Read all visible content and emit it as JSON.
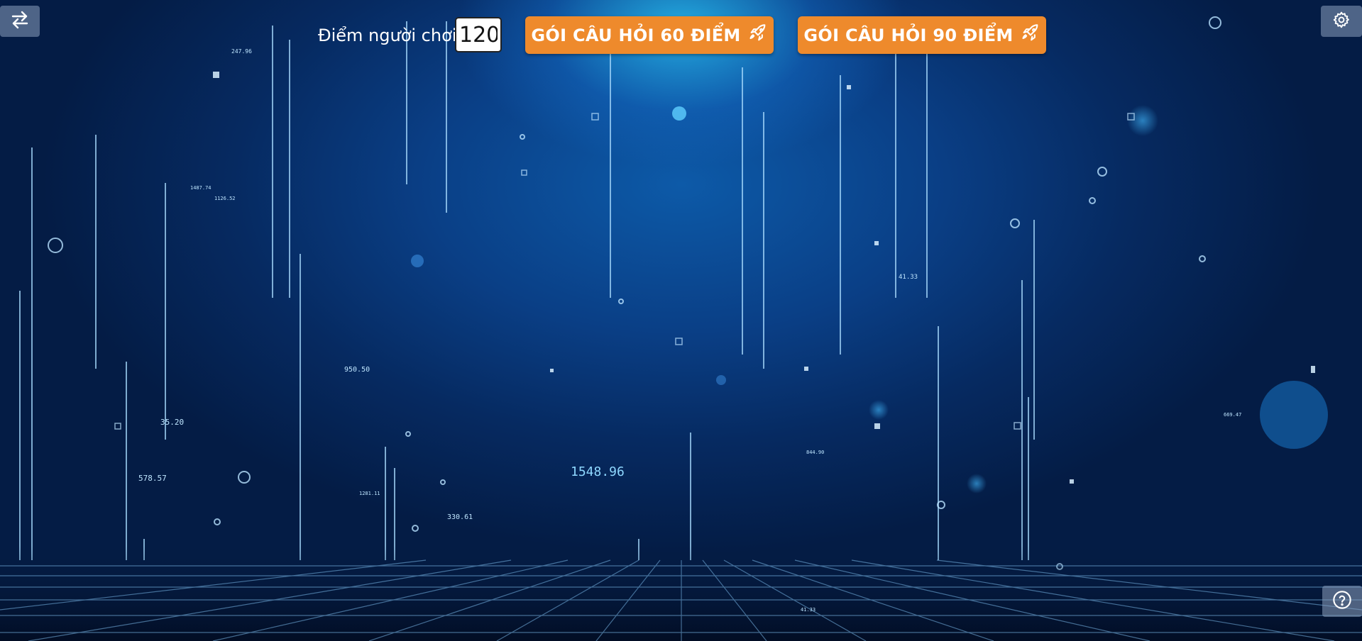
{
  "header": {
    "score_label": "Điểm người chơi:",
    "score_value": "120",
    "package_60_label": "GÓI CÂU HỎI 60 ĐIỂM",
    "package_90_label": "GÓI CÂU HỎI 90 ĐIỂM",
    "rocket_icon": "rocket-icon"
  },
  "toolbar": {
    "swap_icon": "swap-arrows-icon",
    "settings_icon": "gear-icon",
    "help_icon": "question-icon"
  },
  "background_numbers": [
    "1548.96",
    "950.50",
    "35.20",
    "578.57",
    "330.61",
    "41.33",
    "247.96",
    "1126.52",
    "1487.74",
    "1281.11",
    "844.90",
    "41.33",
    "669.47"
  ],
  "colors": {
    "accent": "#ee8a2c",
    "background_dark": "#041c45",
    "background_light": "#0d5aa8"
  }
}
